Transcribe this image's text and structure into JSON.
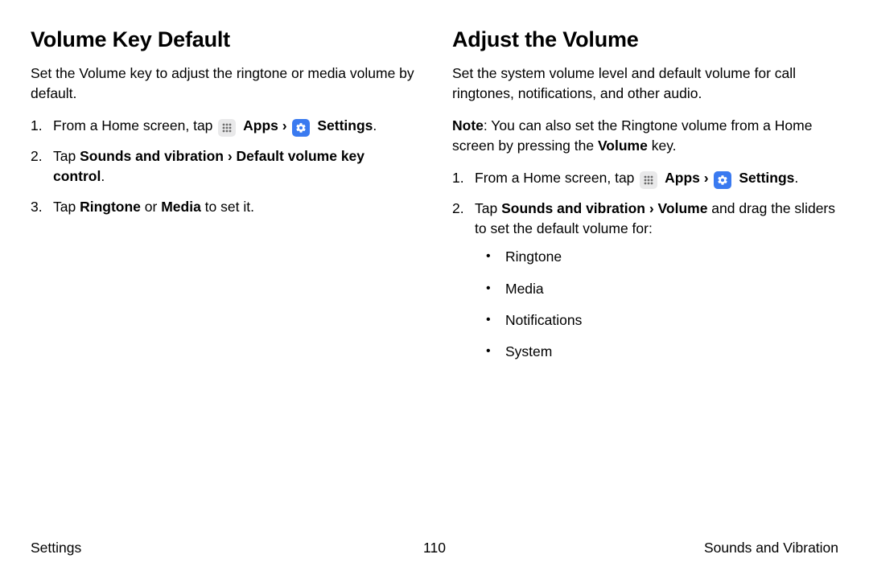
{
  "left": {
    "heading": "Volume Key Default",
    "intro": "Set the Volume key to adjust the ringtone or media volume by default.",
    "step1_prefix": "From a Home screen, tap ",
    "apps_label": "Apps",
    "chevron": "›",
    "settings_label": "Settings",
    "period": ".",
    "step2_a": "Tap ",
    "step2_b": "Sounds and vibration › Default volume key control",
    "step2_c": ".",
    "step3_a": "Tap ",
    "step3_b": "Ringtone",
    "step3_c": " or ",
    "step3_d": "Media",
    "step3_e": " to set it."
  },
  "right": {
    "heading": "Adjust the Volume",
    "intro": "Set the system volume level and default volume for call ringtones, notifications, and other audio.",
    "note_label": "Note",
    "note_a": ": You can also set the Ringtone volume from a Home screen by pressing the ",
    "note_b": "Volume",
    "note_c": " key.",
    "step1_prefix": "From a Home screen, tap ",
    "apps_label": "Apps",
    "chevron": "›",
    "settings_label": "Settings",
    "period": ".",
    "step2_a": "Tap ",
    "step2_b": "Sounds and vibration › Volume",
    "step2_c": " and drag the sliders to set the default volume for:",
    "bullets": {
      "0": "Ringtone",
      "1": "Media",
      "2": "Notifications",
      "3": "System"
    }
  },
  "footer": {
    "left": "Settings",
    "center": "110",
    "right": "Sounds and Vibration"
  }
}
